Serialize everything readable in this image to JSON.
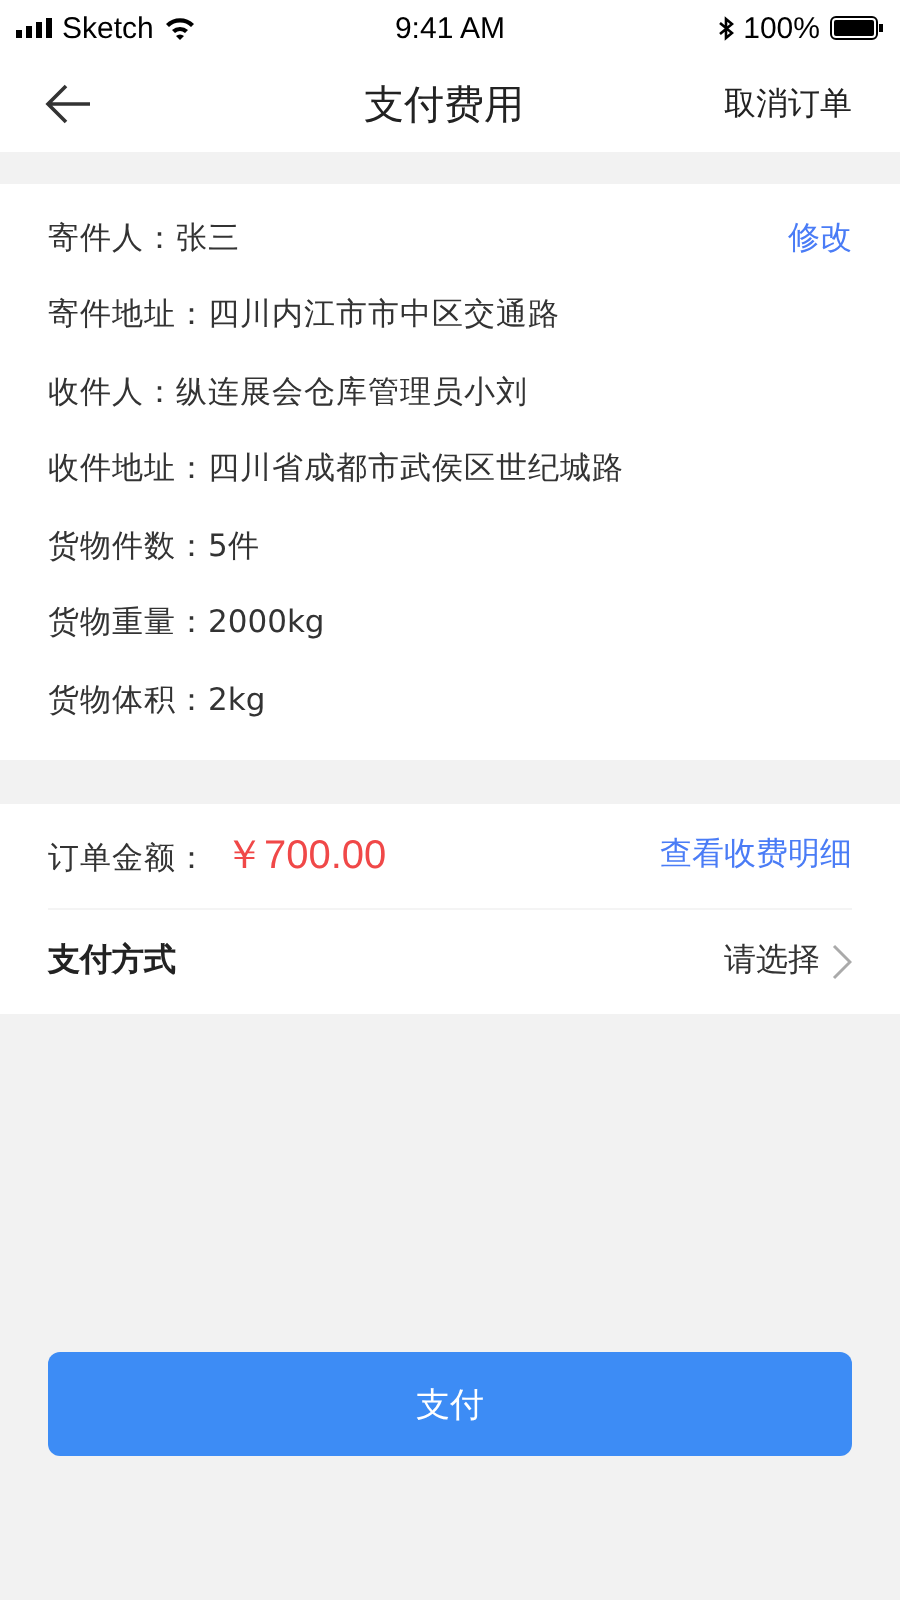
{
  "status_bar": {
    "carrier": "Sketch",
    "time": "9:41 AM",
    "battery": "100%"
  },
  "nav": {
    "title": "支付费用",
    "action": "取消订单"
  },
  "shipment": {
    "edit": "修改",
    "fields": [
      "寄件人：张三",
      "寄件地址：四川内江市市中区交通路",
      "收件人：纵连展会仓库管理员小刘",
      "收件地址：四川省成都市武侯区世纪城路",
      "货物件数：5件",
      "货物重量：2000kg",
      "货物体积：2kg"
    ]
  },
  "order": {
    "amount_label": "订单金额：",
    "amount": "￥700.00",
    "details_link": "查看收费明细",
    "payment_label": "支付方式",
    "payment_value": "请选择"
  },
  "pay_button": "支付"
}
